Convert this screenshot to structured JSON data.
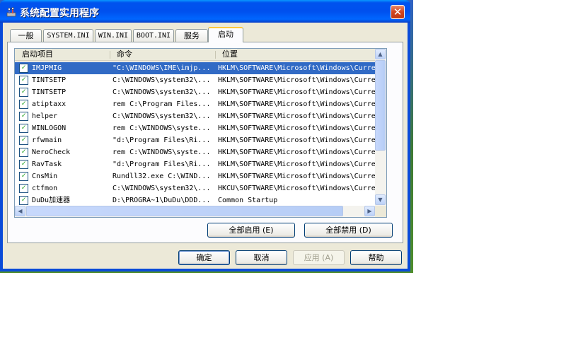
{
  "window": {
    "title": "系统配置实用程序",
    "close_glyph": "✕"
  },
  "tabs": [
    {
      "label": "一般"
    },
    {
      "label": "SYSTEM.INI"
    },
    {
      "label": "WIN.INI"
    },
    {
      "label": "BOOT.INI"
    },
    {
      "label": "服务"
    },
    {
      "label": "启动"
    }
  ],
  "active_tab": "启动",
  "list": {
    "columns": [
      "启动项目",
      "命令",
      "位置"
    ],
    "rows": [
      {
        "checked": true,
        "selected": true,
        "item": "IMJPMIG",
        "command": "\"C:\\WINDOWS\\IME\\imjp...",
        "location": "HKLM\\SOFTWARE\\Microsoft\\Windows\\Curren"
      },
      {
        "checked": true,
        "item": "TINTSETP",
        "command": "C:\\WINDOWS\\system32\\...",
        "location": "HKLM\\SOFTWARE\\Microsoft\\Windows\\Curren"
      },
      {
        "checked": true,
        "item": "TINTSETP",
        "command": "C:\\WINDOWS\\system32\\...",
        "location": "HKLM\\SOFTWARE\\Microsoft\\Windows\\Curren"
      },
      {
        "checked": true,
        "item": "atiptaxx",
        "command": "rem C:\\Program Files...",
        "location": "HKLM\\SOFTWARE\\Microsoft\\Windows\\Curren"
      },
      {
        "checked": true,
        "item": "helper",
        "command": "C:\\WINDOWS\\system32\\...",
        "location": "HKLM\\SOFTWARE\\Microsoft\\Windows\\Curren"
      },
      {
        "checked": true,
        "item": "WINLOGON",
        "command": "rem C:\\WINDOWS\\syste...",
        "location": "HKLM\\SOFTWARE\\Microsoft\\Windows\\Curren"
      },
      {
        "checked": true,
        "item": "rfwmain",
        "command": "\"d:\\Program Files\\Ri...",
        "location": "HKLM\\SOFTWARE\\Microsoft\\Windows\\Curren"
      },
      {
        "checked": true,
        "item": "NeroCheck",
        "command": "rem C:\\WINDOWS\\syste...",
        "location": "HKLM\\SOFTWARE\\Microsoft\\Windows\\Curren"
      },
      {
        "checked": true,
        "item": "RavTask",
        "command": "\"d:\\Program Files\\Ri...",
        "location": "HKLM\\SOFTWARE\\Microsoft\\Windows\\Curren"
      },
      {
        "checked": true,
        "item": "CnsMin",
        "command": "Rundll32.exe C:\\WIND...",
        "location": "HKLM\\SOFTWARE\\Microsoft\\Windows\\Curren"
      },
      {
        "checked": true,
        "item": "ctfmon",
        "command": "C:\\WINDOWS\\system32\\...",
        "location": "HKCU\\SOFTWARE\\Microsoft\\Windows\\Curren"
      },
      {
        "checked": true,
        "item": "DuDu加速器",
        "command": "D:\\PROGRA~1\\DuDu\\DDD...",
        "location": "Common Startup"
      }
    ]
  },
  "buttons": {
    "enable_all": "全部启用 (E)",
    "disable_all": "全部禁用 (D)",
    "ok": "确定",
    "cancel": "取消",
    "apply": "应用 (A)",
    "help": "帮助"
  },
  "scroll_glyphs": {
    "up": "▲",
    "down": "▼",
    "left": "◀",
    "right": "▶",
    "check": "✓"
  }
}
